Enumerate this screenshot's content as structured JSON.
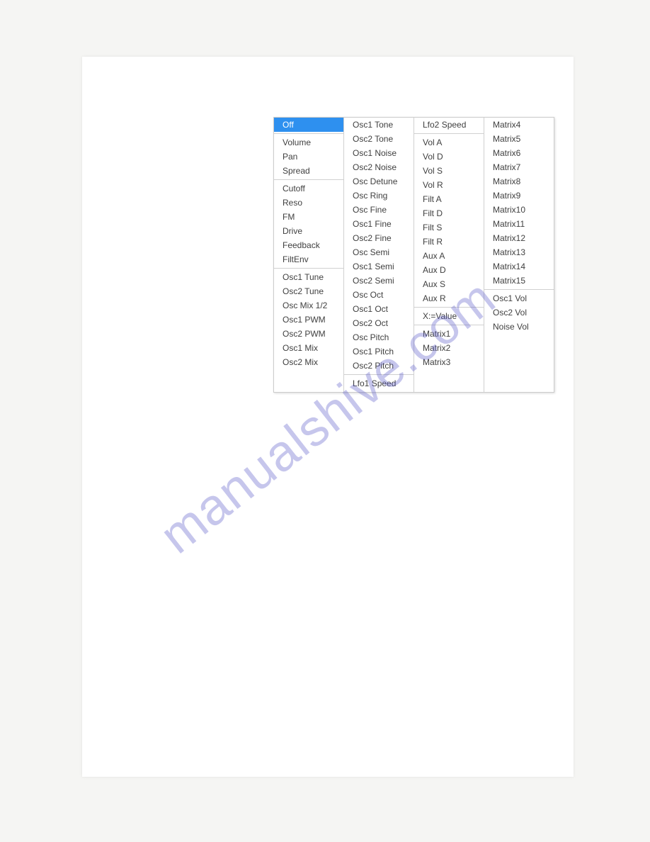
{
  "watermark": "manualshive.com",
  "menu": {
    "columns": [
      {
        "groups": [
          {
            "items": [
              {
                "label": "Off",
                "selected": true
              }
            ]
          },
          {
            "items": [
              {
                "label": "Volume"
              },
              {
                "label": "Pan"
              },
              {
                "label": "Spread"
              }
            ]
          },
          {
            "items": [
              {
                "label": "Cutoff"
              },
              {
                "label": "Reso"
              },
              {
                "label": "FM"
              },
              {
                "label": "Drive"
              },
              {
                "label": "Feedback"
              },
              {
                "label": "FiltEnv"
              }
            ]
          },
          {
            "items": [
              {
                "label": "Osc1 Tune"
              },
              {
                "label": "Osc2 Tune"
              },
              {
                "label": "Osc Mix 1/2"
              },
              {
                "label": "Osc1 PWM"
              },
              {
                "label": "Osc2 PWM"
              },
              {
                "label": "Osc1 Mix"
              },
              {
                "label": "Osc2 Mix"
              }
            ]
          }
        ]
      },
      {
        "groups": [
          {
            "items": [
              {
                "label": "Osc1 Tone"
              },
              {
                "label": "Osc2 Tone"
              },
              {
                "label": "Osc1 Noise"
              },
              {
                "label": "Osc2 Noise"
              },
              {
                "label": "Osc Detune"
              },
              {
                "label": "Osc Ring"
              },
              {
                "label": "Osc Fine"
              },
              {
                "label": "Osc1 Fine"
              },
              {
                "label": "Osc2 Fine"
              },
              {
                "label": "Osc Semi"
              },
              {
                "label": "Osc1 Semi"
              },
              {
                "label": "Osc2 Semi"
              },
              {
                "label": "Osc Oct"
              },
              {
                "label": "Osc1 Oct"
              },
              {
                "label": "Osc2 Oct"
              },
              {
                "label": "Osc Pitch"
              },
              {
                "label": "Osc1 Pitch"
              },
              {
                "label": "Osc2 Pitch"
              }
            ]
          },
          {
            "items": [
              {
                "label": "Lfo1 Speed"
              }
            ]
          }
        ]
      },
      {
        "groups": [
          {
            "items": [
              {
                "label": "Lfo2 Speed"
              }
            ]
          },
          {
            "items": [
              {
                "label": "Vol A"
              },
              {
                "label": "Vol D"
              },
              {
                "label": "Vol S"
              },
              {
                "label": "Vol R"
              },
              {
                "label": "Filt A"
              },
              {
                "label": "Filt D"
              },
              {
                "label": "Filt S"
              },
              {
                "label": "Filt R"
              },
              {
                "label": "Aux A"
              },
              {
                "label": "Aux D"
              },
              {
                "label": "Aux S"
              },
              {
                "label": "Aux R"
              }
            ]
          },
          {
            "items": [
              {
                "label": "X:=Value"
              }
            ]
          },
          {
            "items": [
              {
                "label": "Matrix1"
              },
              {
                "label": "Matrix2"
              },
              {
                "label": "Matrix3"
              }
            ]
          }
        ]
      },
      {
        "groups": [
          {
            "items": [
              {
                "label": "Matrix4"
              },
              {
                "label": "Matrix5"
              },
              {
                "label": "Matrix6"
              },
              {
                "label": "Matrix7"
              },
              {
                "label": "Matrix8"
              },
              {
                "label": "Matrix9"
              },
              {
                "label": "Matrix10"
              },
              {
                "label": "Matrix11"
              },
              {
                "label": "Matrix12"
              },
              {
                "label": "Matrix13"
              },
              {
                "label": "Matrix14"
              },
              {
                "label": "Matrix15"
              }
            ]
          },
          {
            "items": [
              {
                "label": "Osc1 Vol"
              },
              {
                "label": "Osc2 Vol"
              },
              {
                "label": "Noise Vol"
              }
            ]
          }
        ]
      }
    ]
  }
}
